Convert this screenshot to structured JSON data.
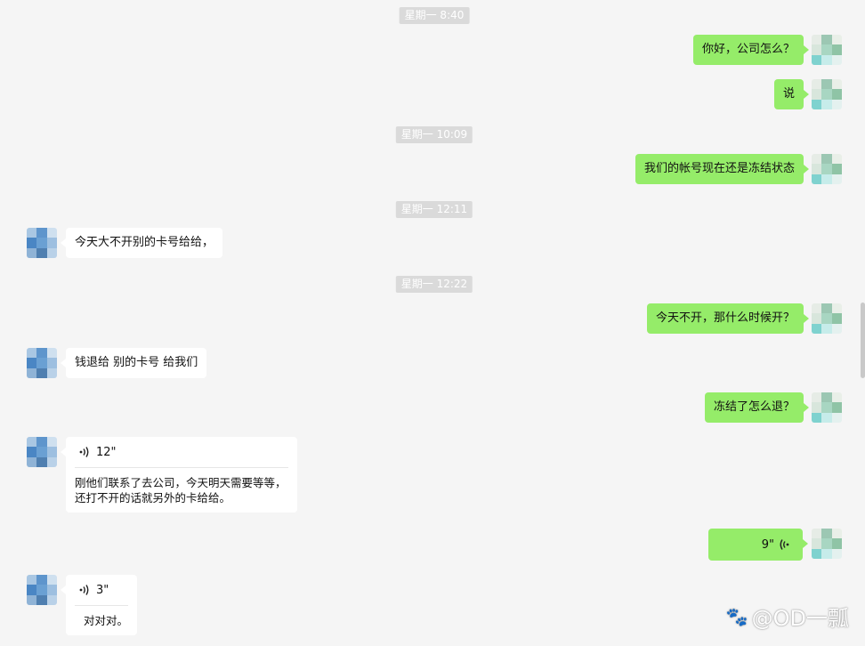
{
  "timestamps": [
    "星期一 8:40",
    "星期一 10:09",
    "星期一 12:11",
    "星期一 12:22"
  ],
  "messages": {
    "m1": "你好，公司怎么？",
    "m2": "说",
    "m3": "我们的帐号现在还是冻结状态",
    "m4": "今天大不开别的卡号给给，",
    "m5": "今天不开，那什么时候开？",
    "m6": "钱退给 别的卡号 给我们",
    "m7": "冻结了怎么退？"
  },
  "voice1": {
    "duration": "12\"",
    "transcript": "刚他们联系了去公司，今天明天需要等等，还打不开的话就另外的卡给给。"
  },
  "voice2": {
    "duration": "9\""
  },
  "voice3": {
    "duration": "3\"",
    "transcript": "对对对。"
  },
  "watermark": {
    "text": "@OD一瓢",
    "icon": "paw-icon"
  },
  "colors": {
    "background": "#f5f5f5",
    "my_bubble": "#95ec69",
    "their_bubble": "#ffffff",
    "timestamp_bg": "#dadada"
  }
}
